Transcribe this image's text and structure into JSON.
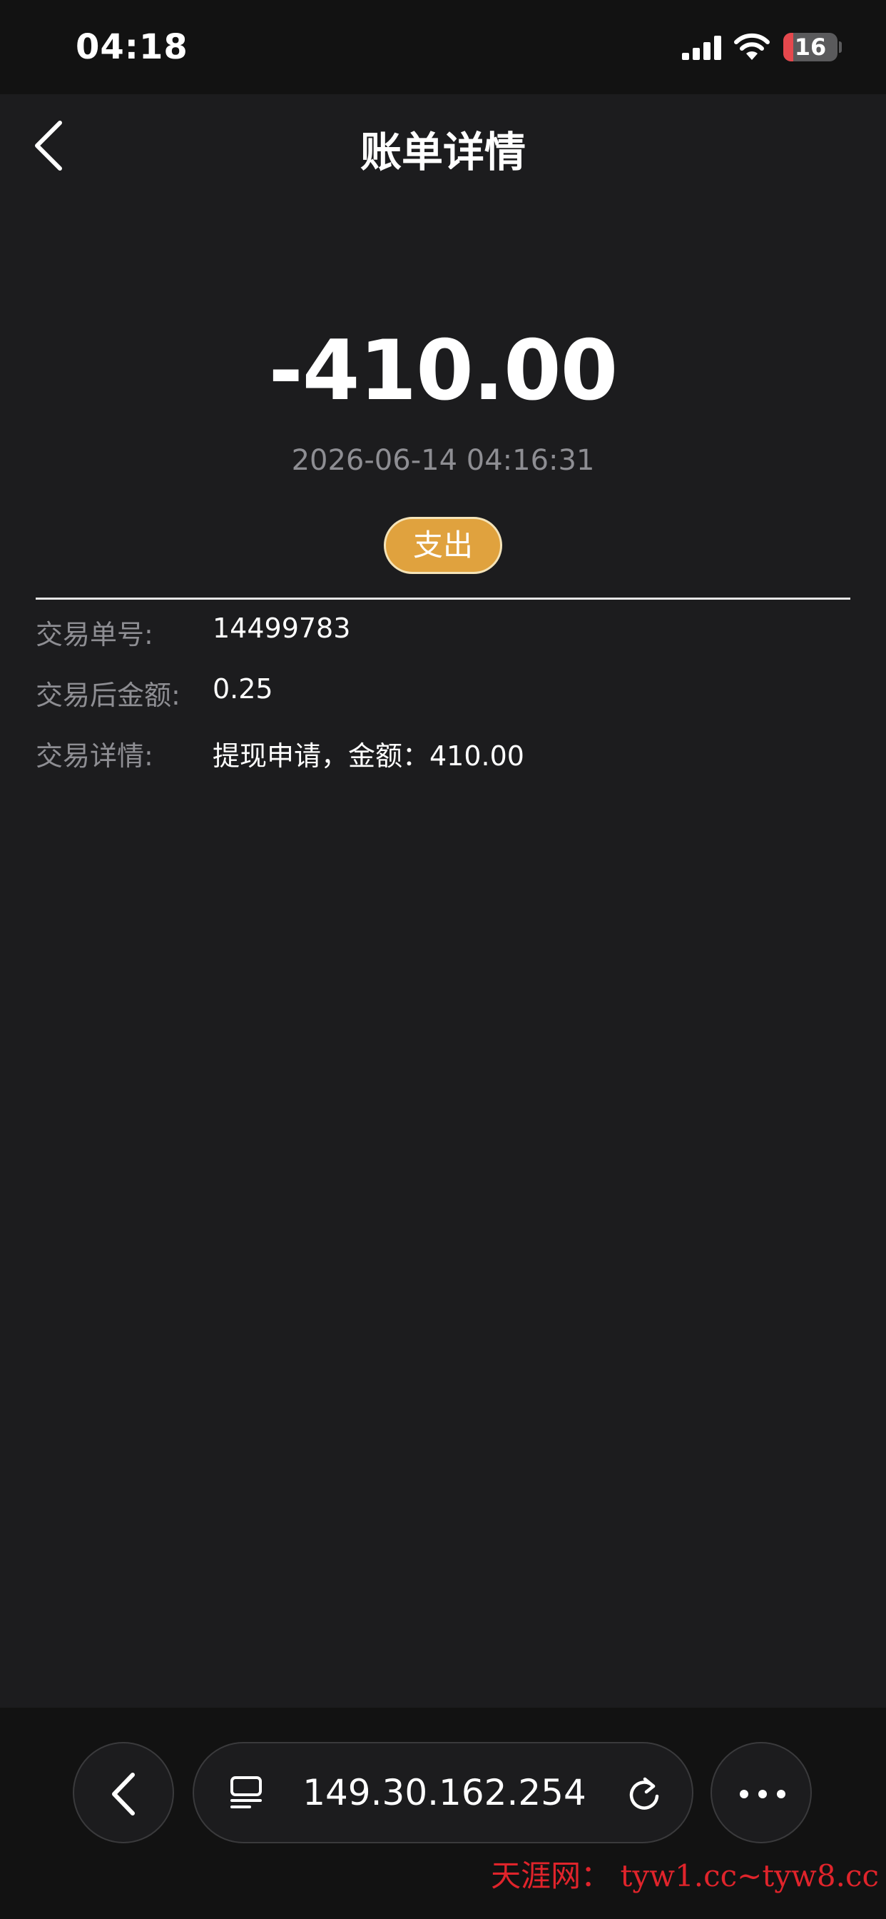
{
  "status_bar": {
    "time": "04:18",
    "battery_level": "16"
  },
  "nav": {
    "title": "账单详情"
  },
  "transaction": {
    "amount": "-410.00",
    "datetime": "2026-06-14 04:16:31",
    "type": "支出"
  },
  "details": [
    {
      "label": "交易单号:",
      "value": "14499783"
    },
    {
      "label": "交易后金额:",
      "value": "0.25"
    },
    {
      "label": "交易详情:",
      "value": "提现申请，金额：410.00"
    }
  ],
  "browser": {
    "url": "149.30.162.254"
  },
  "watermark": "天涯网： tyw1.cc~tyw8.cc"
}
